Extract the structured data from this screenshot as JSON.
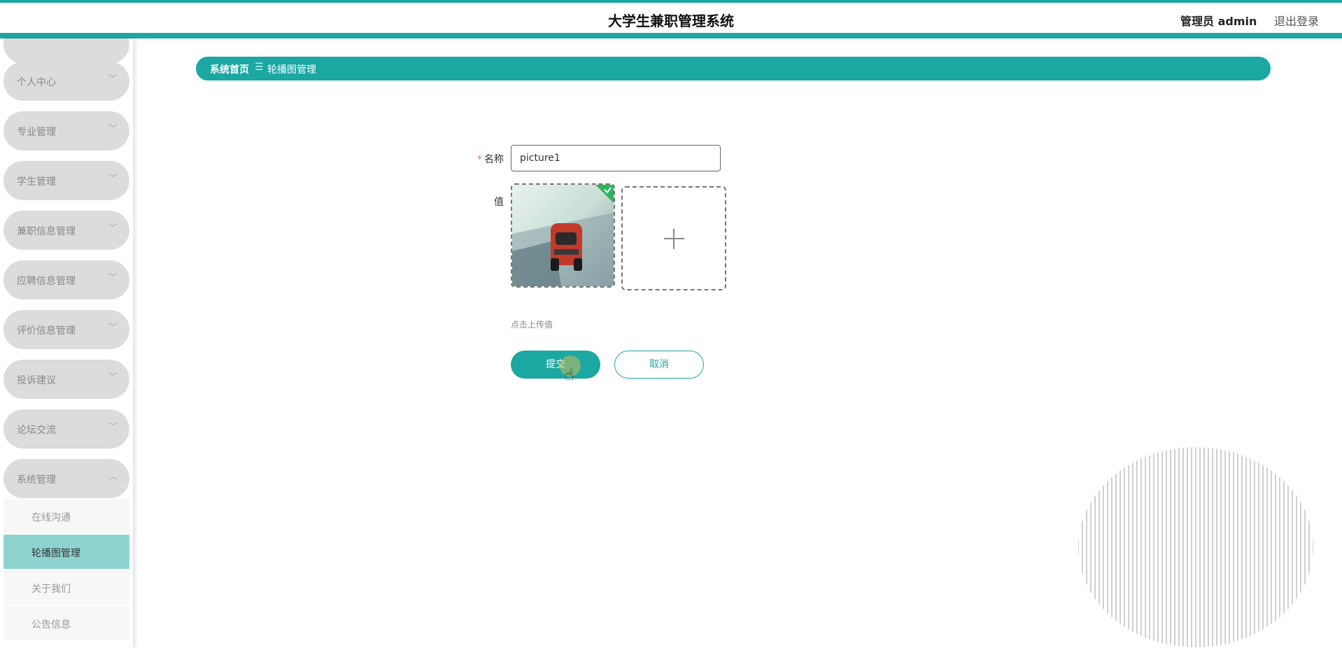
{
  "header": {
    "title": "大学生兼职管理系统",
    "user": "管理员 admin",
    "logout": "退出登录"
  },
  "sidebar": {
    "items": [
      {
        "label": "个人中心",
        "arrow": "﹀"
      },
      {
        "label": "专业管理",
        "arrow": "﹀"
      },
      {
        "label": "学生管理",
        "arrow": "﹀"
      },
      {
        "label": "兼职信息管理",
        "arrow": "﹀"
      },
      {
        "label": "应聘信息管理",
        "arrow": "﹀"
      },
      {
        "label": "评价信息管理",
        "arrow": "﹀"
      },
      {
        "label": "投诉建议",
        "arrow": "﹀"
      },
      {
        "label": "论坛交流",
        "arrow": "﹀"
      },
      {
        "label": "系统管理",
        "arrow": "︿"
      }
    ],
    "subitems": [
      {
        "label": "在线沟通"
      },
      {
        "label": "轮播图管理"
      },
      {
        "label": "关于我们"
      },
      {
        "label": "公告信息"
      }
    ]
  },
  "breadcrumb": {
    "home": "系统首页",
    "separator": "☰",
    "current": "轮播图管理"
  },
  "form": {
    "name_label": "名称",
    "required_mark": "*",
    "name_value": "picture1",
    "value_label": "值",
    "upload_tip": "点击上传值",
    "submit_label": "提交",
    "cancel_label": "取消"
  },
  "colors": {
    "accent": "#1ba7a2",
    "active_submenu": "#8fd3d0",
    "menu_bg": "#dcdcdc"
  }
}
